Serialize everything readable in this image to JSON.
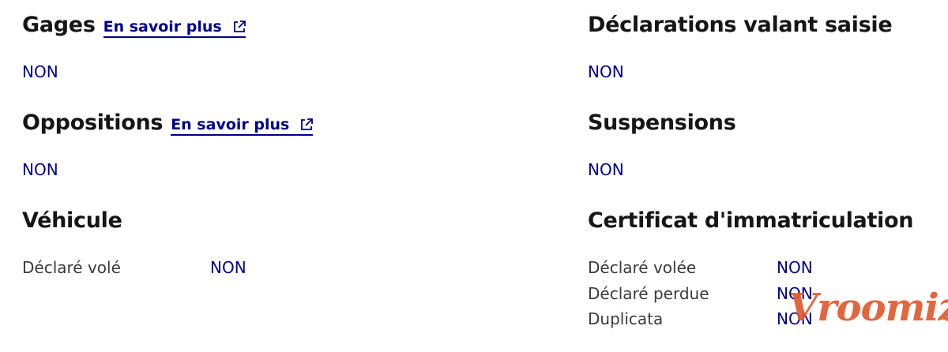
{
  "left": {
    "gages": {
      "title": "Gages",
      "link": "En savoir plus",
      "value": "NON"
    },
    "oppositions": {
      "title": "Oppositions",
      "link": "En savoir plus",
      "value": "NON"
    },
    "vehicule": {
      "title": "Véhicule",
      "fields": [
        {
          "label": "Déclaré volé",
          "value": "NON"
        }
      ]
    }
  },
  "right": {
    "declarations": {
      "title": "Déclarations valant saisie",
      "value": "NON"
    },
    "suspensions": {
      "title": "Suspensions",
      "value": "NON"
    },
    "certificat": {
      "title": "Certificat d'immatriculation",
      "fields": [
        {
          "label": "Déclaré volée",
          "value": "NON"
        },
        {
          "label": "Déclaré perdue",
          "value": "NON"
        },
        {
          "label": "Duplicata",
          "value": "NON"
        }
      ]
    }
  },
  "watermark": "Vroomiz",
  "colors": {
    "accent": "#000091",
    "text": "#161616",
    "watermark": "#e05a2e"
  },
  "icons": {
    "external_link": "external-link-icon"
  }
}
